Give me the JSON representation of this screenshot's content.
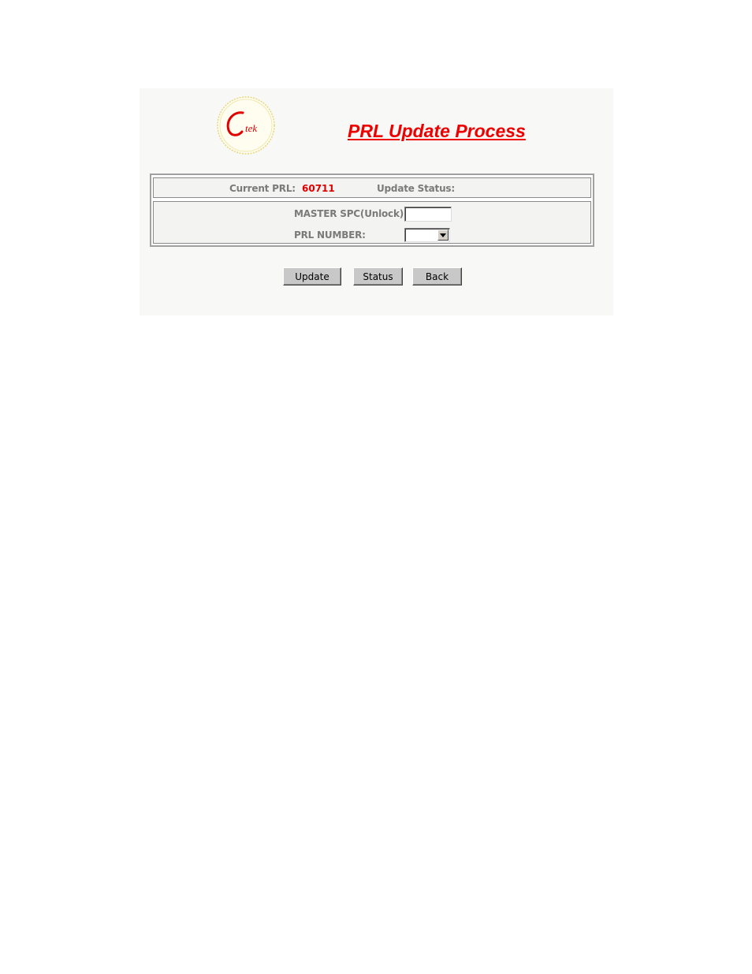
{
  "header": {
    "logo_text": "Ctek",
    "title": "PRL Update Process"
  },
  "info": {
    "current_prl_label": "Current PRL:",
    "current_prl_value": "60711",
    "update_status_label": "Update Status:",
    "update_status_value": ""
  },
  "form": {
    "master_spc_label": "MASTER SPC(Unlock):",
    "master_spc_value": "",
    "prl_number_label": "PRL NUMBER:",
    "prl_number_selected": ""
  },
  "buttons": {
    "update": "Update",
    "status": "Status",
    "back": "Back"
  },
  "colors": {
    "title": "#ee0000",
    "prl_value": "#e00000",
    "labels": "#7a7a7a",
    "logo_ring": "#e6d77a"
  },
  "icons": {
    "select_arrow": "chevron-down-icon"
  }
}
